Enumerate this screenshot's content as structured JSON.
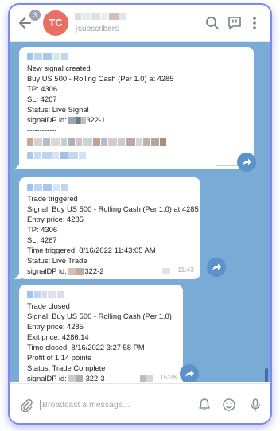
{
  "header": {
    "unread_count": "3",
    "avatar_initials": "TC",
    "subtitle": "subscribers"
  },
  "messages": [
    {
      "lines": [
        "New signal created",
        "Buy US 500 - Rolling Cash (Per 1.0) at 4285",
        "TP: 4306",
        "SL: 4267",
        "Status: Live Signal"
      ],
      "id_label": "signalDP id:",
      "id_suffix": "322-1",
      "separator": "------------",
      "time": ""
    },
    {
      "lines": [
        "Trade triggered",
        "Signal: Buy US 500 - Rolling Cash (Per 1.0) at 4285",
        "Entry price: 4285",
        "TP: 4306",
        "SL: 4267",
        "Time triggered: 8/16/2022 11:43:05 AM",
        "Status: Live Trade"
      ],
      "id_label": "signalDP id:",
      "id_suffix": "322-2",
      "time": "11:43"
    },
    {
      "lines": [
        "Trade closed",
        "Signal: Buy US 500 - Rolling Cash (Per 1.0)",
        "Entry price: 4285",
        "Exit price: 4286.14",
        "Time closed: 8/16/2022 3:27:58 PM",
        "Profit of 1.14 points",
        "Status: Trade Complete"
      ],
      "id_label": "signalDP id:",
      "id_suffix": "-322-3",
      "time": "15:28"
    }
  ],
  "composer": {
    "placeholder": "Broadcast a message..."
  },
  "colors": {
    "accent": "#7d8aeb",
    "chat_background": "#7aaad6",
    "avatar": "#ea6e63",
    "share_button": "#5a93c9"
  },
  "icons": [
    "back-arrow-icon",
    "search-icon",
    "comment-icon",
    "more-vertical-icon",
    "share-icon",
    "attach-icon",
    "bell-icon",
    "smile-icon",
    "microphone-icon"
  ]
}
